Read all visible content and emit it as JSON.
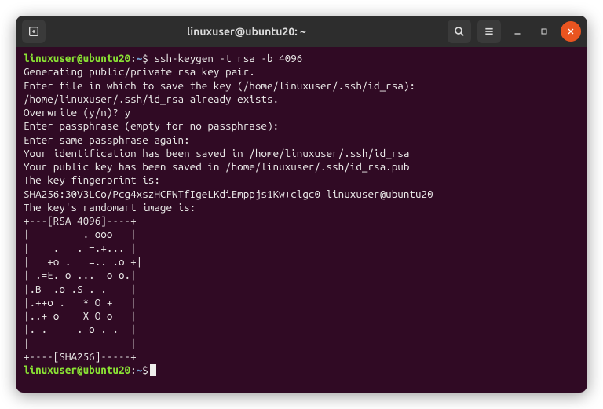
{
  "titlebar": {
    "title": "linuxuser@ubuntu20: ~"
  },
  "prompt": {
    "user_host": "linuxuser@ubuntu20",
    "separator": ":",
    "path": "~",
    "symbol": "$"
  },
  "command": "ssh-keygen -t rsa -b 4096",
  "output": [
    "Generating public/private rsa key pair.",
    "Enter file in which to save the key (/home/linuxuser/.ssh/id_rsa):",
    "/home/linuxuser/.ssh/id_rsa already exists.",
    "Overwrite (y/n)? y",
    "Enter passphrase (empty for no passphrase):",
    "Enter same passphrase again:",
    "Your identification has been saved in /home/linuxuser/.ssh/id_rsa",
    "Your public key has been saved in /home/linuxuser/.ssh/id_rsa.pub",
    "The key fingerprint is:",
    "SHA256:30V3LCo/Pcg4xszHCFWTfIgeLKdiEmppjs1Kw+clgc0 linuxuser@ubuntu20",
    "The key's randomart image is:",
    "+---[RSA 4096]----+",
    "|         . ooo   |",
    "|    .   . =.+... |",
    "|   +o .   =.. .o +|",
    "| .=E. o ...  o o.|",
    "|.B  .o .S . .    |",
    "|.++o .   * O +   |",
    "|..+ o    X O o   |",
    "|. .     . o . .  |",
    "|                 |",
    "+----[SHA256]-----+"
  ]
}
